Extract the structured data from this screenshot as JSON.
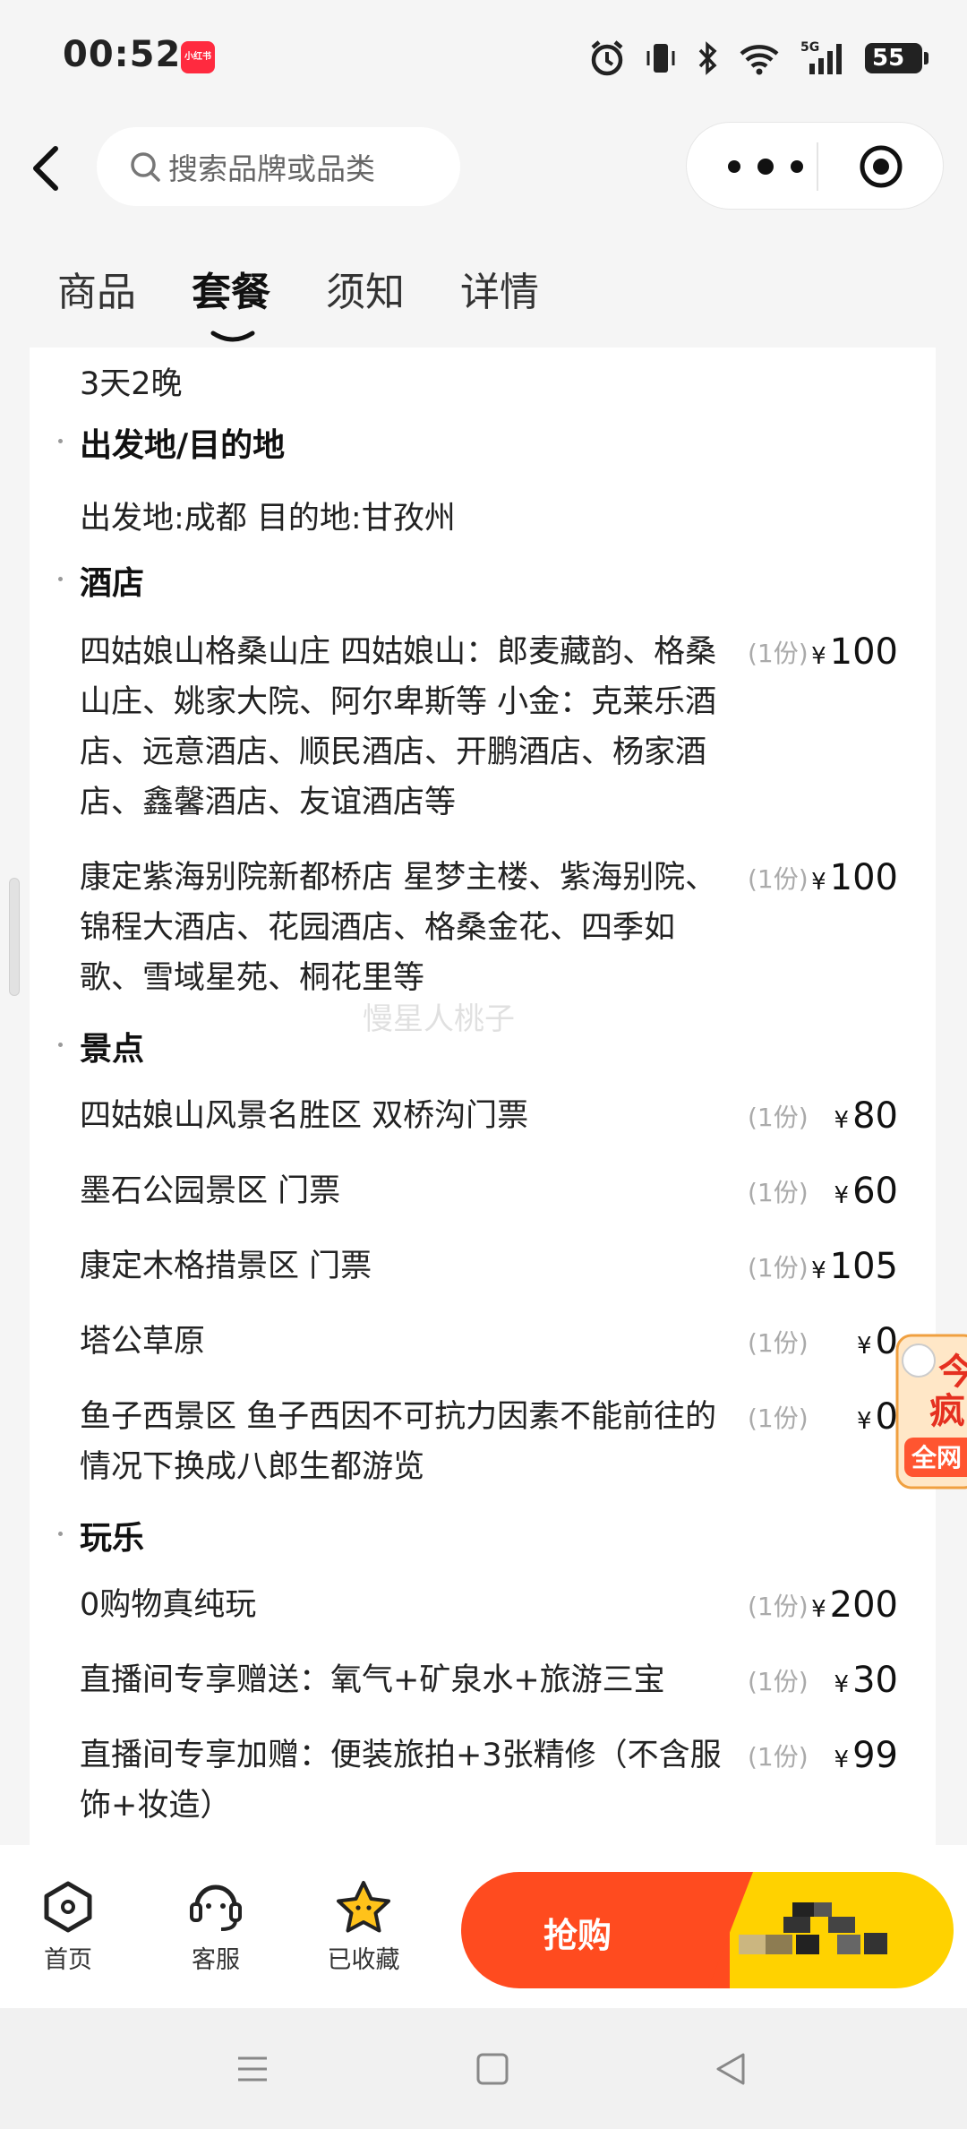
{
  "status_bar": {
    "time": "00:52",
    "app_badge": "小红书",
    "battery": "55"
  },
  "header": {
    "search_placeholder": "搜索品牌或品类"
  },
  "tabs": [
    {
      "label": "商品",
      "active": false
    },
    {
      "label": "套餐",
      "active": true
    },
    {
      "label": "须知",
      "active": false
    },
    {
      "label": "详情",
      "active": false
    }
  ],
  "content": {
    "duration": "3天2晚",
    "sections": {
      "origin": {
        "title": "出发地/目的地",
        "text": "出发地:成都 目的地:甘孜州"
      },
      "hotel": {
        "title": "酒店",
        "items": [
          {
            "name": "四姑娘山格桑山庄 四姑娘山：郎麦藏韵、格桑山庄、姚家大院、阿尔卑斯等 小金：克莱乐酒店、远意酒店、顺民酒店、开鹏酒店、杨家酒店、鑫馨酒店、友谊酒店等",
            "qty": "(1份)",
            "currency": "¥",
            "price": "100"
          },
          {
            "name": "康定紫海别院新都桥店 星梦主楼、紫海别院、锦程大酒店、花园酒店、格桑金花、四季如歌、雪域星苑、桐花里等",
            "qty": "(1份)",
            "currency": "¥",
            "price": "100"
          }
        ]
      },
      "scenic": {
        "title": "景点",
        "items": [
          {
            "name": "四姑娘山风景名胜区 双桥沟门票",
            "qty": "(1份)",
            "currency": "¥",
            "price": "80"
          },
          {
            "name": "墨石公园景区 门票",
            "qty": "(1份)",
            "currency": "¥",
            "price": "60"
          },
          {
            "name": "康定木格措景区 门票",
            "qty": "(1份)",
            "currency": "¥",
            "price": "105"
          },
          {
            "name": "塔公草原",
            "qty": "(1份)",
            "currency": "¥",
            "price": "0"
          },
          {
            "name": "鱼子西景区 鱼子西因不可抗力因素不能前往的情况下换成八郎生都游览",
            "qty": "(1份)",
            "currency": "¥",
            "price": "0"
          }
        ]
      },
      "fun": {
        "title": "玩乐",
        "items": [
          {
            "name": "0购物真纯玩",
            "qty": "(1份)",
            "currency": "¥",
            "price": "200"
          },
          {
            "name": "直播间专享赠送：氧气+矿泉水+旅游三宝",
            "qty": "(1份)",
            "currency": "¥",
            "price": "30"
          },
          {
            "name": "直播间专享加赠：便装旅拍+3张精修（不含服饰+妆造）",
            "qty": "(1份)",
            "currency": "¥",
            "price": "99"
          }
        ]
      }
    },
    "watermark": "慢星人桃子"
  },
  "side_float": {
    "line1": "今",
    "line2": "疯",
    "line3": "全网"
  },
  "bottom_bar": {
    "home": "首页",
    "service": "客服",
    "favorite": "已收藏",
    "buy": "抢购"
  },
  "colors": {
    "buy_orange": "#ff4b1f",
    "buy_yellow": "#ffd200",
    "star_yellow": "#ffc21a"
  }
}
